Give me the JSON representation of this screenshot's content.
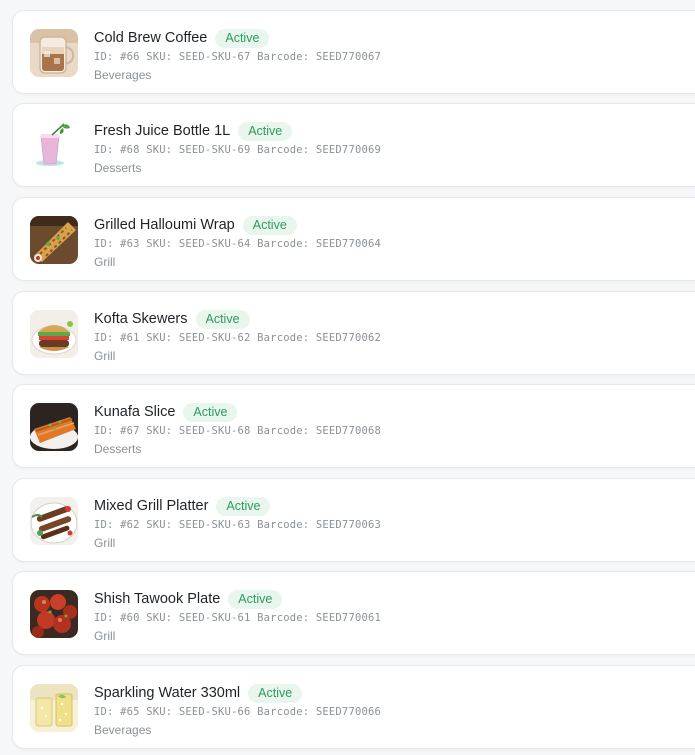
{
  "products": [
    {
      "name": "Cold Brew Coffee",
      "status": "Active",
      "id": "#66",
      "sku": "SEED-SKU-67",
      "barcode": "SEED770067",
      "category": "Beverages",
      "image": "cold-brew-coffee-image"
    },
    {
      "name": "Fresh Juice Bottle 1L",
      "status": "Active",
      "id": "#68",
      "sku": "SEED-SKU-69",
      "barcode": "SEED770069",
      "category": "Desserts",
      "image": "fresh-juice-image"
    },
    {
      "name": "Grilled Halloumi Wrap",
      "status": "Active",
      "id": "#63",
      "sku": "SEED-SKU-64",
      "barcode": "SEED770064",
      "category": "Grill",
      "image": "halloumi-wrap-image"
    },
    {
      "name": "Kofta Skewers",
      "status": "Active",
      "id": "#61",
      "sku": "SEED-SKU-62",
      "barcode": "SEED770062",
      "category": "Grill",
      "image": "kofta-skewers-image"
    },
    {
      "name": "Kunafa Slice",
      "status": "Active",
      "id": "#67",
      "sku": "SEED-SKU-68",
      "barcode": "SEED770068",
      "category": "Desserts",
      "image": "kunafa-slice-image"
    },
    {
      "name": "Mixed Grill Platter",
      "status": "Active",
      "id": "#62",
      "sku": "SEED-SKU-63",
      "barcode": "SEED770063",
      "category": "Grill",
      "image": "mixed-grill-image"
    },
    {
      "name": "Shish Tawook Plate",
      "status": "Active",
      "id": "#60",
      "sku": "SEED-SKU-61",
      "barcode": "SEED770061",
      "category": "Grill",
      "image": "shish-tawook-image"
    },
    {
      "name": "Sparkling Water 330ml",
      "status": "Active",
      "id": "#65",
      "sku": "SEED-SKU-66",
      "barcode": "SEED770066",
      "category": "Beverages",
      "image": "sparkling-water-image"
    }
  ],
  "labels": {
    "id_prefix": "ID:",
    "sku_prefix": "SKU:",
    "barcode_prefix": "Barcode:"
  },
  "colors": {
    "badge_bg": "#e8f6ee",
    "badge_text": "#2e9a5c",
    "card_border": "#e6e8eb"
  }
}
